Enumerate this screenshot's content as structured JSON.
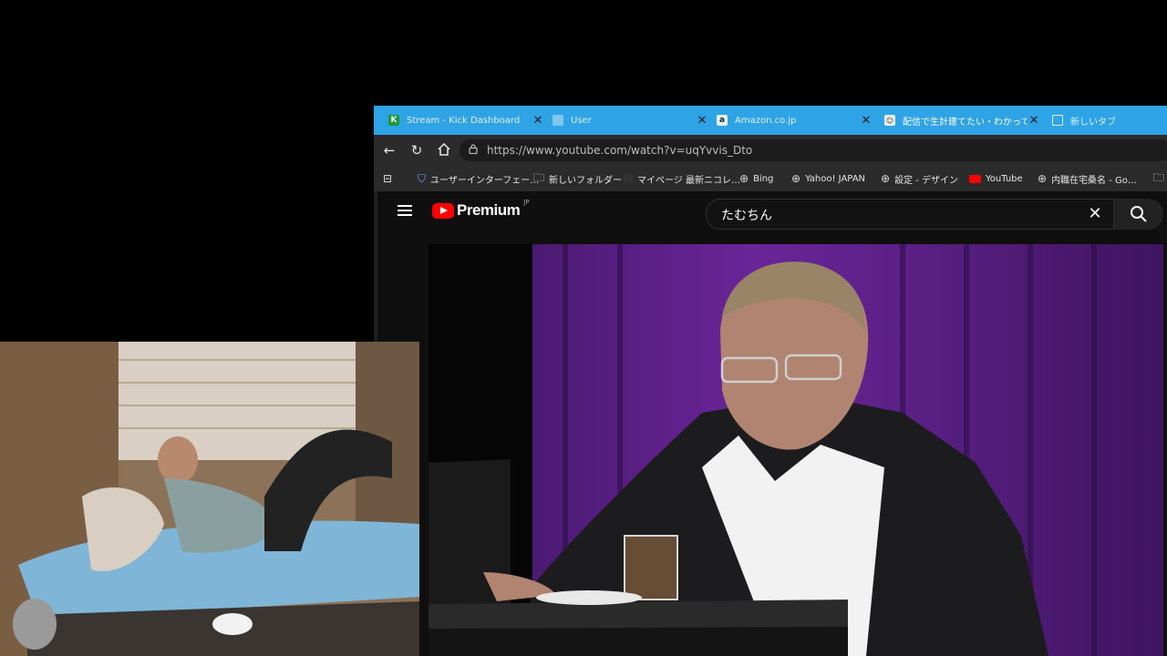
{
  "browser": {
    "tabs": [
      {
        "title": "Stream - Kick Dashboard",
        "icon": "kick-icon",
        "color": "#53fc18"
      },
      {
        "title": "User",
        "icon": "user-page-icon",
        "color": "#7ec8f0"
      },
      {
        "title": "Amazon.co.jp",
        "icon": "amazon-icon",
        "color": "#ffffff"
      },
      {
        "title": "配信で生計建てたい・わかってん…",
        "icon": "page-icon",
        "color": "#ffffff"
      },
      {
        "title": "新しいタブ",
        "icon": "new-tab-icon",
        "color": "#ffffff"
      }
    ],
    "url": "https://www.youtube.com/watch?v=uqYvvis_Dto",
    "bookmarks": [
      {
        "label": "ユーザーインターフェー…",
        "icon": "shield-icon"
      },
      {
        "label": "新しいフォルダー",
        "icon": "folder-icon"
      },
      {
        "label": "マイページ 最新ニコレ…",
        "icon": "niconico-icon"
      },
      {
        "label": "Bing",
        "icon": "globe-icon"
      },
      {
        "label": "Yahoo! JAPAN",
        "icon": "globe-icon"
      },
      {
        "label": "設定 - デザイン",
        "icon": "globe-icon"
      },
      {
        "label": "YouTube",
        "icon": "youtube-icon"
      },
      {
        "label": "内職在宅桑名 - Go…",
        "icon": "globe-icon"
      }
    ]
  },
  "youtube": {
    "logo_text": "Premium",
    "logo_region": "JP",
    "search_value": "たむちん"
  },
  "colors": {
    "tab_bar": "#2ea3e6",
    "youtube_red": "#ff0000",
    "curtain": "#5a2085"
  }
}
